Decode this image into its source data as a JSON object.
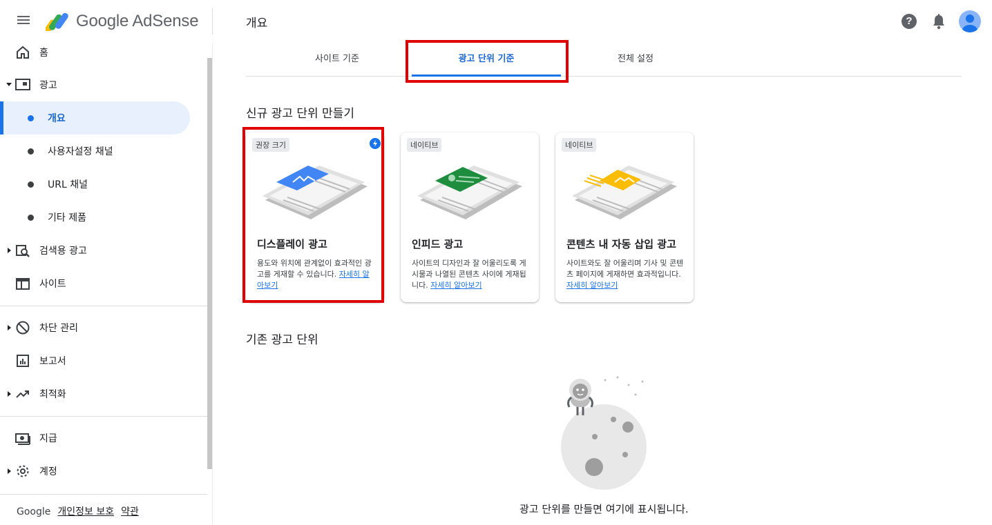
{
  "header": {
    "brand": "Google AdSense",
    "page_title": "개요",
    "help_glyph": "?"
  },
  "sidebar": {
    "items": [
      {
        "label": "홈",
        "icon": "home-icon"
      },
      {
        "label": "광고",
        "icon": "ads-icon"
      },
      {
        "label": "개요"
      },
      {
        "label": "사용자설정 채널"
      },
      {
        "label": "URL 채널"
      },
      {
        "label": "기타 제품"
      },
      {
        "label": "검색용 광고",
        "icon": "search-ads-icon"
      },
      {
        "label": "사이트",
        "icon": "sites-icon"
      },
      {
        "label": "차단 관리",
        "icon": "block-icon"
      },
      {
        "label": "보고서",
        "icon": "reports-icon"
      },
      {
        "label": "최적화",
        "icon": "optimize-icon"
      },
      {
        "label": "지급",
        "icon": "payments-icon"
      },
      {
        "label": "계정",
        "icon": "gear-icon"
      }
    ],
    "footer": {
      "brand": "Google",
      "privacy": "개인정보 보호",
      "terms": "약관"
    }
  },
  "tabs": [
    {
      "label": "사이트 기준"
    },
    {
      "label": "광고 단위 기준"
    },
    {
      "label": "전체 설정"
    }
  ],
  "main": {
    "create_title": "신규 광고 단위 만들기",
    "existing_title": "기존 광고 단위",
    "empty_message": "광고 단위를 만들면 여기에 표시됩니다.",
    "cards": [
      {
        "chip": "권장 크기",
        "title": "디스플레이 광고",
        "desc": "용도와 위치에 관계없이 효과적인 광고를 게재할 수 있습니다. ",
        "link": "자세히 알아보기",
        "accent": "#4285f4"
      },
      {
        "chip": "네이티브",
        "title": "인피드 광고",
        "desc": "사이트의 디자인과 잘 어울리도록 게시물과 나열된 콘텐츠 사이에 게재됩니다. ",
        "link": "자세히 알아보기",
        "accent": "#1e8e3e"
      },
      {
        "chip": "네이티브",
        "title": "콘텐츠 내 자동 삽입 광고",
        "desc": "사이트와도 잘 어울리며 기사 및 콘텐츠 페이지에 게재하면 효과적입니다. ",
        "link": "자세히 알아보기",
        "accent": "#fbbc04"
      }
    ]
  },
  "colors": {
    "primary": "#1a73e8",
    "highlight": "#e00000"
  }
}
